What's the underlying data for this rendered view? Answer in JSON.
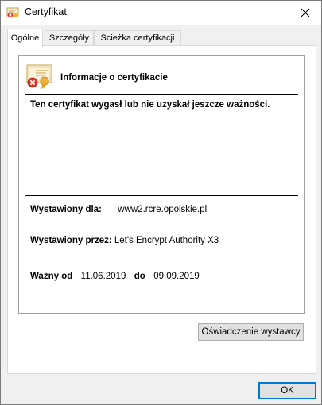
{
  "window": {
    "title": "Certyfikat"
  },
  "tabs": [
    {
      "label": "Ogólne",
      "active": true
    },
    {
      "label": "Szczegóły",
      "active": false
    },
    {
      "label": "Ścieżka certyfikacji",
      "active": false
    }
  ],
  "certificate": {
    "heading": "Informacje o certyfikacie",
    "warning": "Ten certyfikat wygasł lub nie uzyskał jeszcze ważności.",
    "issued_to_label": "Wystawiony dla:",
    "issued_to_value": "www2.rcre.opolskie.pl",
    "issued_by_label": "Wystawiony przez:",
    "issued_by_value": "Let's Encrypt Authority X3",
    "valid_from_label": "Ważny od",
    "valid_from_value": "11.06.2019",
    "valid_to_label": "do",
    "valid_to_value": "09.09.2019"
  },
  "buttons": {
    "issuer_statement": "Oświadczenie wystawcy",
    "ok": "OK"
  },
  "colors": {
    "accent": "#0078d7",
    "error": "#d9342b",
    "seal": "#f2b13a"
  }
}
